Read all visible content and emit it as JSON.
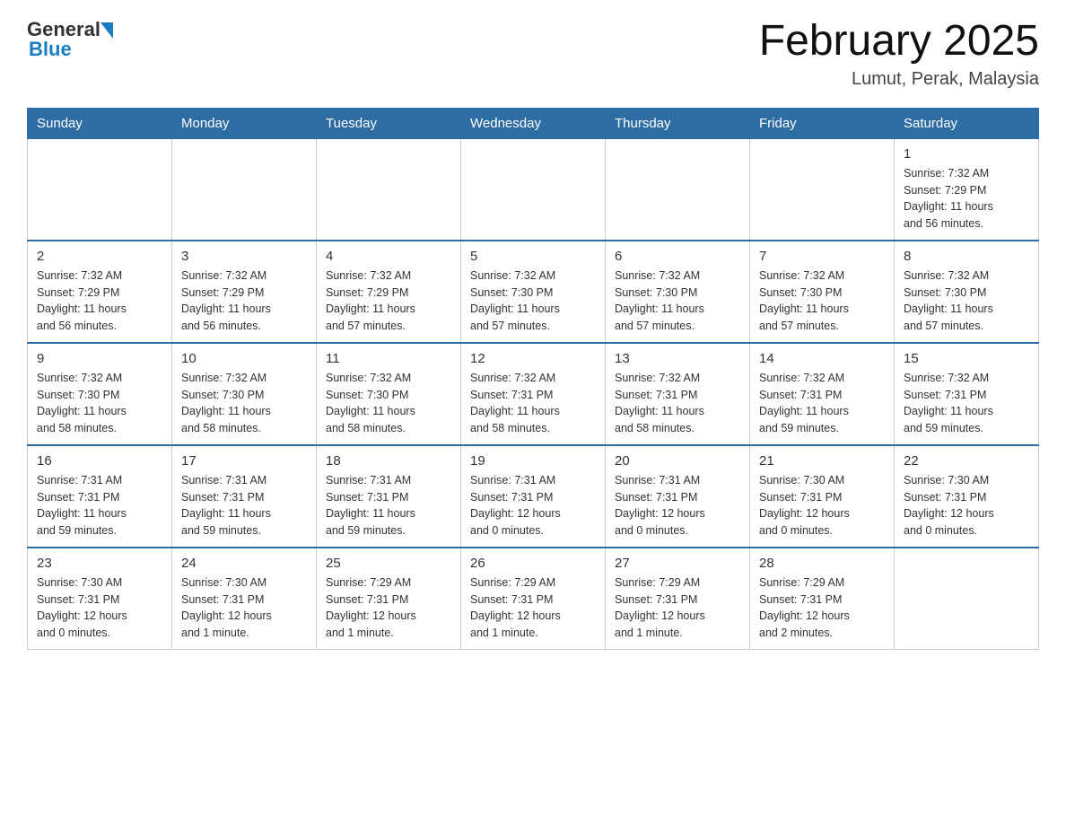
{
  "header": {
    "logo_general": "General",
    "logo_blue": "Blue",
    "title": "February 2025",
    "location": "Lumut, Perak, Malaysia"
  },
  "weekdays": [
    "Sunday",
    "Monday",
    "Tuesday",
    "Wednesday",
    "Thursday",
    "Friday",
    "Saturday"
  ],
  "weeks": [
    [
      {
        "day": "",
        "info": ""
      },
      {
        "day": "",
        "info": ""
      },
      {
        "day": "",
        "info": ""
      },
      {
        "day": "",
        "info": ""
      },
      {
        "day": "",
        "info": ""
      },
      {
        "day": "",
        "info": ""
      },
      {
        "day": "1",
        "info": "Sunrise: 7:32 AM\nSunset: 7:29 PM\nDaylight: 11 hours\nand 56 minutes."
      }
    ],
    [
      {
        "day": "2",
        "info": "Sunrise: 7:32 AM\nSunset: 7:29 PM\nDaylight: 11 hours\nand 56 minutes."
      },
      {
        "day": "3",
        "info": "Sunrise: 7:32 AM\nSunset: 7:29 PM\nDaylight: 11 hours\nand 56 minutes."
      },
      {
        "day": "4",
        "info": "Sunrise: 7:32 AM\nSunset: 7:29 PM\nDaylight: 11 hours\nand 57 minutes."
      },
      {
        "day": "5",
        "info": "Sunrise: 7:32 AM\nSunset: 7:30 PM\nDaylight: 11 hours\nand 57 minutes."
      },
      {
        "day": "6",
        "info": "Sunrise: 7:32 AM\nSunset: 7:30 PM\nDaylight: 11 hours\nand 57 minutes."
      },
      {
        "day": "7",
        "info": "Sunrise: 7:32 AM\nSunset: 7:30 PM\nDaylight: 11 hours\nand 57 minutes."
      },
      {
        "day": "8",
        "info": "Sunrise: 7:32 AM\nSunset: 7:30 PM\nDaylight: 11 hours\nand 57 minutes."
      }
    ],
    [
      {
        "day": "9",
        "info": "Sunrise: 7:32 AM\nSunset: 7:30 PM\nDaylight: 11 hours\nand 58 minutes."
      },
      {
        "day": "10",
        "info": "Sunrise: 7:32 AM\nSunset: 7:30 PM\nDaylight: 11 hours\nand 58 minutes."
      },
      {
        "day": "11",
        "info": "Sunrise: 7:32 AM\nSunset: 7:30 PM\nDaylight: 11 hours\nand 58 minutes."
      },
      {
        "day": "12",
        "info": "Sunrise: 7:32 AM\nSunset: 7:31 PM\nDaylight: 11 hours\nand 58 minutes."
      },
      {
        "day": "13",
        "info": "Sunrise: 7:32 AM\nSunset: 7:31 PM\nDaylight: 11 hours\nand 58 minutes."
      },
      {
        "day": "14",
        "info": "Sunrise: 7:32 AM\nSunset: 7:31 PM\nDaylight: 11 hours\nand 59 minutes."
      },
      {
        "day": "15",
        "info": "Sunrise: 7:32 AM\nSunset: 7:31 PM\nDaylight: 11 hours\nand 59 minutes."
      }
    ],
    [
      {
        "day": "16",
        "info": "Sunrise: 7:31 AM\nSunset: 7:31 PM\nDaylight: 11 hours\nand 59 minutes."
      },
      {
        "day": "17",
        "info": "Sunrise: 7:31 AM\nSunset: 7:31 PM\nDaylight: 11 hours\nand 59 minutes."
      },
      {
        "day": "18",
        "info": "Sunrise: 7:31 AM\nSunset: 7:31 PM\nDaylight: 11 hours\nand 59 minutes."
      },
      {
        "day": "19",
        "info": "Sunrise: 7:31 AM\nSunset: 7:31 PM\nDaylight: 12 hours\nand 0 minutes."
      },
      {
        "day": "20",
        "info": "Sunrise: 7:31 AM\nSunset: 7:31 PM\nDaylight: 12 hours\nand 0 minutes."
      },
      {
        "day": "21",
        "info": "Sunrise: 7:30 AM\nSunset: 7:31 PM\nDaylight: 12 hours\nand 0 minutes."
      },
      {
        "day": "22",
        "info": "Sunrise: 7:30 AM\nSunset: 7:31 PM\nDaylight: 12 hours\nand 0 minutes."
      }
    ],
    [
      {
        "day": "23",
        "info": "Sunrise: 7:30 AM\nSunset: 7:31 PM\nDaylight: 12 hours\nand 0 minutes."
      },
      {
        "day": "24",
        "info": "Sunrise: 7:30 AM\nSunset: 7:31 PM\nDaylight: 12 hours\nand 1 minute."
      },
      {
        "day": "25",
        "info": "Sunrise: 7:29 AM\nSunset: 7:31 PM\nDaylight: 12 hours\nand 1 minute."
      },
      {
        "day": "26",
        "info": "Sunrise: 7:29 AM\nSunset: 7:31 PM\nDaylight: 12 hours\nand 1 minute."
      },
      {
        "day": "27",
        "info": "Sunrise: 7:29 AM\nSunset: 7:31 PM\nDaylight: 12 hours\nand 1 minute."
      },
      {
        "day": "28",
        "info": "Sunrise: 7:29 AM\nSunset: 7:31 PM\nDaylight: 12 hours\nand 2 minutes."
      },
      {
        "day": "",
        "info": ""
      }
    ]
  ]
}
